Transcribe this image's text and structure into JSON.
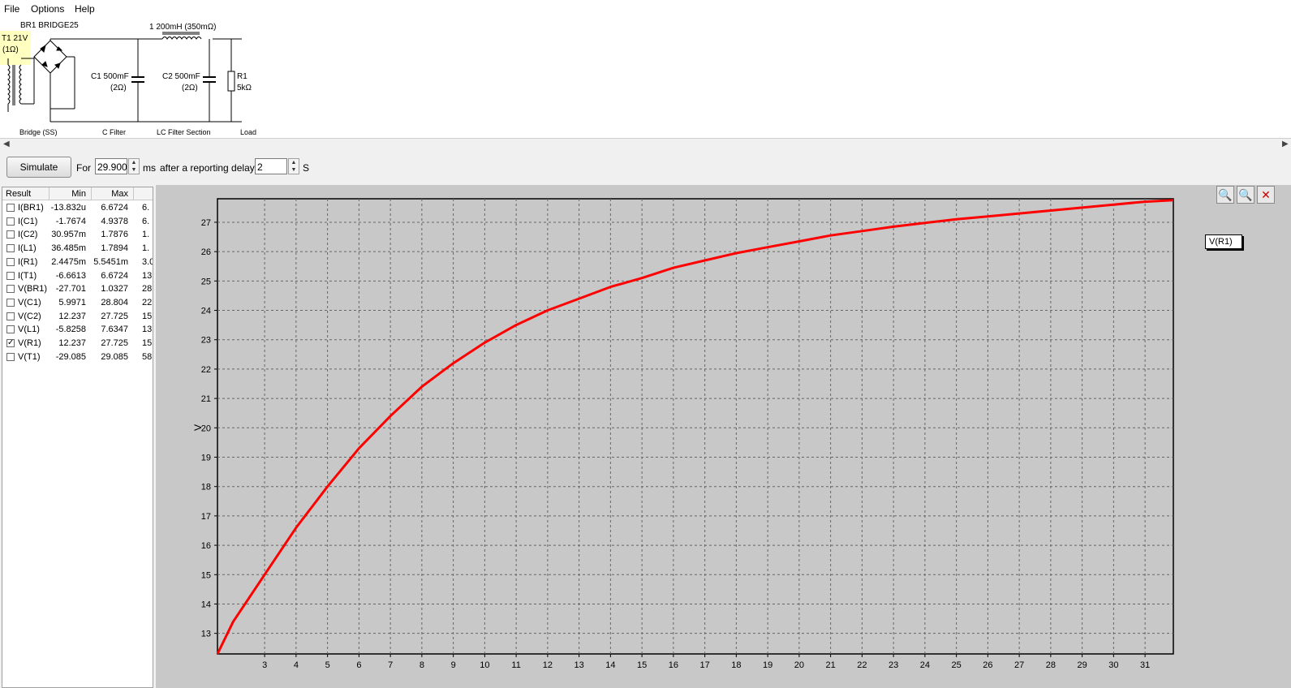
{
  "menu": {
    "file": "File",
    "options": "Options",
    "help": "Help"
  },
  "schematic": {
    "bridge_label": "BR1 BRIDGE25",
    "transformer_label": "T1 21V",
    "transformer_res": "(1Ω)",
    "inductor_label": "1 200mH (350mΩ)",
    "c1_label": "C1 500mF",
    "c1_res": "(2Ω)",
    "c2_label": "C2 500mF",
    "c2_res": "(2Ω)",
    "r1_label": "R1",
    "r1_value": "5kΩ",
    "sections": {
      "bridge": "Bridge (SS)",
      "cfilter": "C Filter",
      "lcfilter": "LC Filter Section",
      "load": "Load"
    }
  },
  "toolbar": {
    "simulate": "Simulate",
    "for_label": "For",
    "duration": "29.900",
    "ms_label": "ms",
    "delay_label": "after a reporting delay of",
    "delay": "2",
    "s_label": "S"
  },
  "results": {
    "headers": {
      "result": "Result",
      "min": "Min",
      "max": "Max"
    },
    "rows": [
      {
        "name": "I(BR1)",
        "min": "-13.832u",
        "max": "6.6724",
        "extra": "6.",
        "checked": false
      },
      {
        "name": "I(C1)",
        "min": "-1.7674",
        "max": "4.9378",
        "extra": "6.",
        "checked": false
      },
      {
        "name": "I(C2)",
        "min": "30.957m",
        "max": "1.7876",
        "extra": "1.",
        "checked": false
      },
      {
        "name": "I(L1)",
        "min": "36.485m",
        "max": "1.7894",
        "extra": "1.",
        "checked": false
      },
      {
        "name": "I(R1)",
        "min": "2.4475m",
        "max": "5.5451m",
        "extra": "3.0",
        "checked": false
      },
      {
        "name": "I(T1)",
        "min": "-6.6613",
        "max": "6.6724",
        "extra": "13",
        "checked": false
      },
      {
        "name": "V(BR1)",
        "min": "-27.701",
        "max": "1.0327",
        "extra": "28",
        "checked": false
      },
      {
        "name": "V(C1)",
        "min": "5.9971",
        "max": "28.804",
        "extra": "22",
        "checked": false
      },
      {
        "name": "V(C2)",
        "min": "12.237",
        "max": "27.725",
        "extra": "15",
        "checked": false
      },
      {
        "name": "V(L1)",
        "min": "-5.8258",
        "max": "7.6347",
        "extra": "13",
        "checked": false
      },
      {
        "name": "V(R1)",
        "min": "12.237",
        "max": "27.725",
        "extra": "15",
        "checked": true
      },
      {
        "name": "V(T1)",
        "min": "-29.085",
        "max": "29.085",
        "extra": "58",
        "checked": false
      }
    ]
  },
  "icons": {
    "zoom_in": "zoom-in-icon",
    "zoom_out": "zoom-out-icon",
    "zoom_reset": "zoom-reset-icon"
  },
  "colors": {
    "trace": "#ff0000",
    "plot_bg": "#c8c8c8"
  },
  "chart_data": {
    "type": "line",
    "ylabel": "V",
    "xlabel": "",
    "xlim": [
      1.5,
      31.9
    ],
    "ylim": [
      12.3,
      27.8
    ],
    "xticks": [
      3,
      4,
      5,
      6,
      7,
      8,
      9,
      10,
      11,
      12,
      13,
      14,
      15,
      16,
      17,
      18,
      19,
      20,
      21,
      22,
      23,
      24,
      25,
      26,
      27,
      28,
      29,
      30,
      31
    ],
    "yticks": [
      13,
      14,
      15,
      16,
      17,
      18,
      19,
      20,
      21,
      22,
      23,
      24,
      25,
      26,
      27
    ],
    "grid": true,
    "legend_position": "top-right",
    "series": [
      {
        "name": "V(R1)",
        "color": "#ff0000",
        "x": [
          1.5,
          2,
          3,
          4,
          5,
          6,
          7,
          8,
          9,
          10,
          11,
          12,
          13,
          14,
          15,
          16,
          17,
          18,
          19,
          20,
          21,
          22,
          23,
          24,
          25,
          26,
          27,
          28,
          29,
          30,
          31,
          31.9
        ],
        "y": [
          12.3,
          13.4,
          15.0,
          16.6,
          18.0,
          19.3,
          20.4,
          21.4,
          22.2,
          22.9,
          23.5,
          24.0,
          24.4,
          24.8,
          25.1,
          25.45,
          25.7,
          25.95,
          26.15,
          26.35,
          26.55,
          26.7,
          26.85,
          26.98,
          27.1,
          27.2,
          27.3,
          27.4,
          27.5,
          27.6,
          27.7,
          27.75
        ]
      }
    ]
  }
}
